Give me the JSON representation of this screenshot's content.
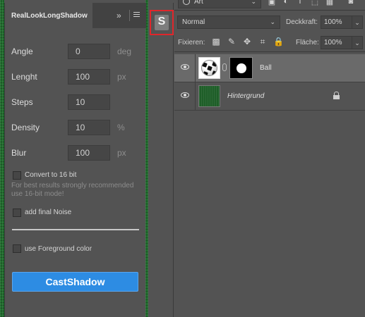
{
  "extension": {
    "tab_title": "RealLookLongShadow",
    "collapse_glyph": "»",
    "fields": [
      {
        "label": "Angle",
        "value": "0",
        "unit": "deg"
      },
      {
        "label": "Lenght",
        "value": "100",
        "unit": "px"
      },
      {
        "label": "Steps",
        "value": "10",
        "unit": ""
      },
      {
        "label": "Density",
        "value": "10",
        "unit": "%"
      },
      {
        "label": "Blur",
        "value": "100",
        "unit": "px"
      }
    ],
    "convert16": {
      "label": "Convert to 16 bit",
      "checked": false
    },
    "hint": "For best results strongly recommended use 16-bit mode!",
    "add_noise": {
      "label": "add final Noise",
      "checked": false
    },
    "use_fg": {
      "label": "use Foreground color",
      "checked": false
    },
    "cast_button": "CastShadow",
    "accent_color": "#2d8ce3"
  },
  "toggle": {
    "label": "S",
    "highlight_color": "#e0262b"
  },
  "layers_panel": {
    "filter_kind": "Art",
    "blend_mode": "Normal",
    "opacity_label": "Deckkraft:",
    "opacity_value": "100%",
    "lock_label": "Fixieren:",
    "fill_label": "Fläche:",
    "fill_value": "100%",
    "layers": [
      {
        "name": "Ball",
        "visible": true,
        "selected": true,
        "has_mask": true
      },
      {
        "name": "Hintergrund",
        "visible": true,
        "selected": false,
        "locked": true
      }
    ]
  }
}
